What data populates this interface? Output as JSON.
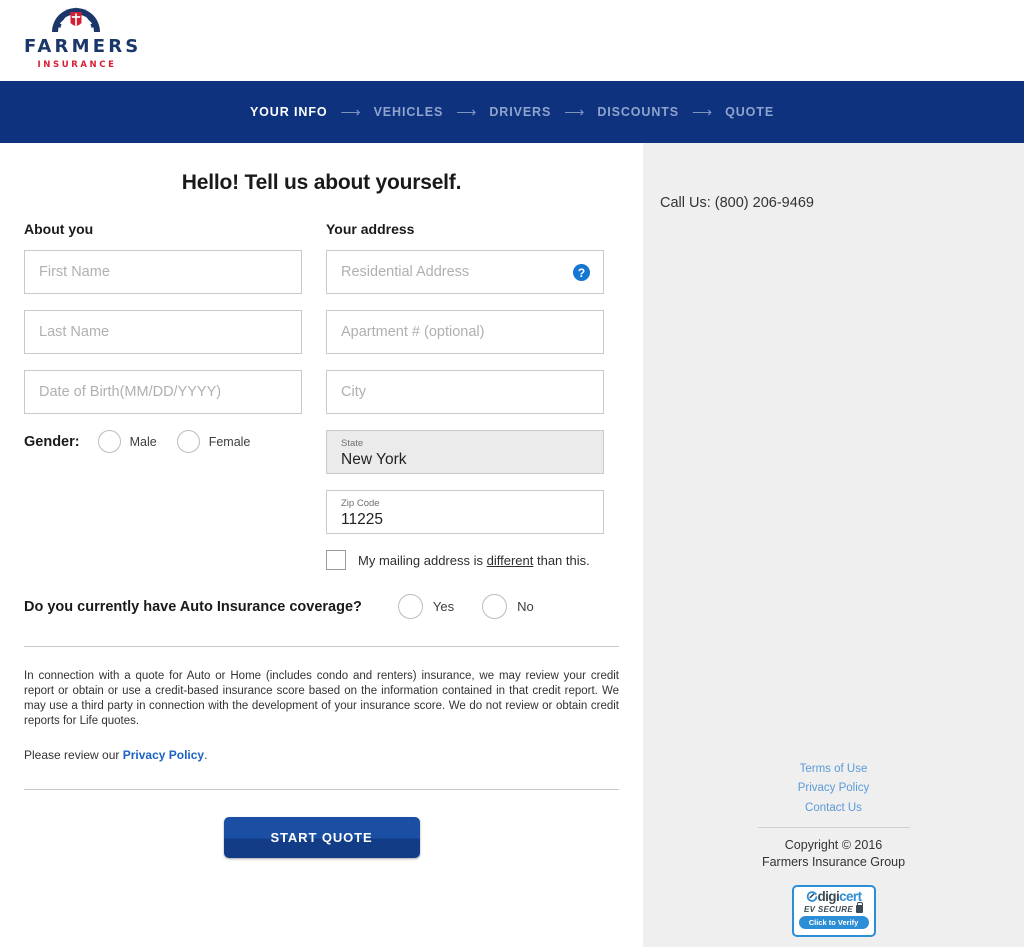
{
  "brand": {
    "logo_word": "FARMERS",
    "logo_sub": "INSURANCE",
    "navy": "#0e327e",
    "red": "#d81e34",
    "link_blue": "#5b9bd5"
  },
  "stepnav": {
    "steps": [
      {
        "label": "YOUR INFO",
        "active": true
      },
      {
        "label": "VEHICLES",
        "active": false
      },
      {
        "label": "DRIVERS",
        "active": false
      },
      {
        "label": "DISCOUNTS",
        "active": false
      },
      {
        "label": "QUOTE",
        "active": false
      }
    ],
    "arrow": "⟶"
  },
  "main": {
    "title": "Hello! Tell us about yourself.",
    "about_you": {
      "heading": "About you",
      "first_name_placeholder": "First Name",
      "last_name_placeholder": "Last Name",
      "dob_placeholder": "Date of Birth(MM/DD/YYYY)",
      "gender_label": "Gender:",
      "gender_male": "Male",
      "gender_female": "Female"
    },
    "your_address": {
      "heading": "Your address",
      "residential_placeholder": "Residential Address",
      "help_icon": "?",
      "apartment_placeholder": "Apartment # (optional)",
      "city_placeholder": "City",
      "state_label": "State",
      "state_value": "New York",
      "zip_label": "Zip Code",
      "zip_value": "11225",
      "mailing_prefix": "My mailing address is ",
      "mailing_emphasis": "different",
      "mailing_suffix": " than this."
    },
    "coverage": {
      "question": "Do you currently have Auto Insurance coverage?",
      "yes": "Yes",
      "no": "No"
    },
    "disclaimer": "In connection with a quote for Auto or Home (includes condo and renters) insurance, we may review your credit report or obtain or use a credit-based insurance score based on the information contained in that credit report. We may use a third party in connection with the development of your insurance score. We do not review or obtain credit reports for Life quotes.",
    "privacy_prefix": "Please review our ",
    "privacy_link": "Privacy Policy",
    "privacy_suffix": ".",
    "start_button": "START QUOTE"
  },
  "sidebar": {
    "call_us": "Call Us: (800) 206-9469",
    "links": [
      {
        "label": "Terms of Use"
      },
      {
        "label": "Privacy Policy"
      },
      {
        "label": "Contact Us"
      }
    ],
    "copyright_line1": "Copyright © 2016",
    "copyright_line2": "Farmers Insurance Group",
    "seal": {
      "name_part1": "digi",
      "name_part2": "cert",
      "ev": "EV SECURE",
      "verify": "Click to Verify"
    }
  }
}
